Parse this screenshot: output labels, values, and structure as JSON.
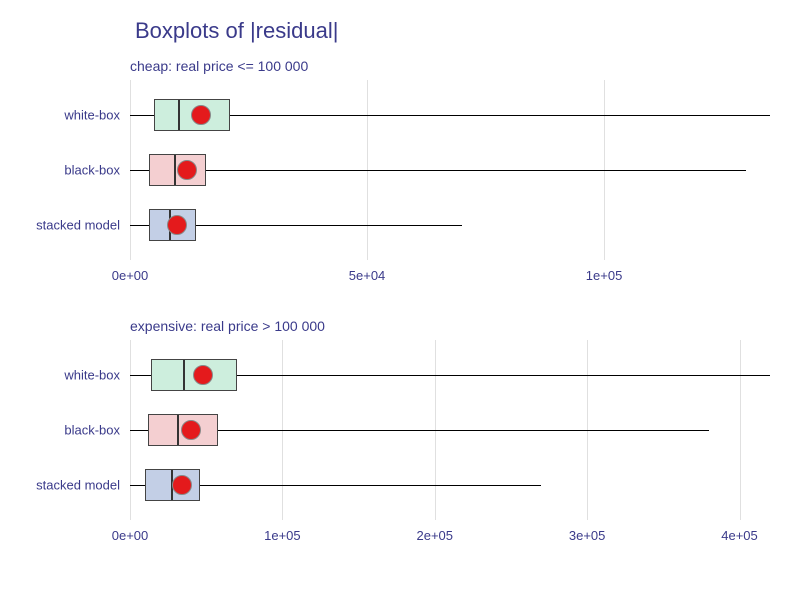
{
  "title": "Boxplots of |residual|",
  "chart_data": [
    {
      "type": "boxplot",
      "subtitle": "cheap: real price <= 100 000",
      "xlabel": "",
      "ylabel": "",
      "xticks": [
        0,
        50000,
        100000
      ],
      "xtick_labels": [
        "0e+00",
        "5e+04",
        "1e+05"
      ],
      "xlim": [
        0,
        135000
      ],
      "categories": [
        "white-box",
        "black-box",
        "stacked model"
      ],
      "series": [
        {
          "name": "white-box",
          "low": 0,
          "q1": 5000,
          "median": 10000,
          "q3": 21000,
          "high": 135000,
          "mean": 15000,
          "fill": "#cdeedd"
        },
        {
          "name": "black-box",
          "low": 0,
          "q1": 4000,
          "median": 9000,
          "q3": 16000,
          "high": 130000,
          "mean": 12000,
          "fill": "#f4cfd1"
        },
        {
          "name": "stacked model",
          "low": 0,
          "q1": 4000,
          "median": 8000,
          "q3": 14000,
          "high": 70000,
          "mean": 10000,
          "fill": "#c3cfe6"
        }
      ]
    },
    {
      "type": "boxplot",
      "subtitle": "expensive: real price > 100 000",
      "xlabel": "",
      "ylabel": "",
      "xticks": [
        0,
        100000,
        200000,
        300000,
        400000
      ],
      "xtick_labels": [
        "0e+00",
        "1e+05",
        "2e+05",
        "3e+05",
        "4e+05"
      ],
      "xlim": [
        0,
        420000
      ],
      "categories": [
        "white-box",
        "black-box",
        "stacked model"
      ],
      "series": [
        {
          "name": "white-box",
          "low": 0,
          "q1": 14000,
          "median": 34000,
          "q3": 70000,
          "high": 420000,
          "mean": 48000,
          "fill": "#cdeedd"
        },
        {
          "name": "black-box",
          "low": 0,
          "q1": 12000,
          "median": 30000,
          "q3": 58000,
          "high": 380000,
          "mean": 40000,
          "fill": "#f4cfd1"
        },
        {
          "name": "stacked model",
          "low": 0,
          "q1": 10000,
          "median": 26000,
          "q3": 46000,
          "high": 270000,
          "mean": 34000,
          "fill": "#c3cfe6"
        }
      ]
    }
  ]
}
